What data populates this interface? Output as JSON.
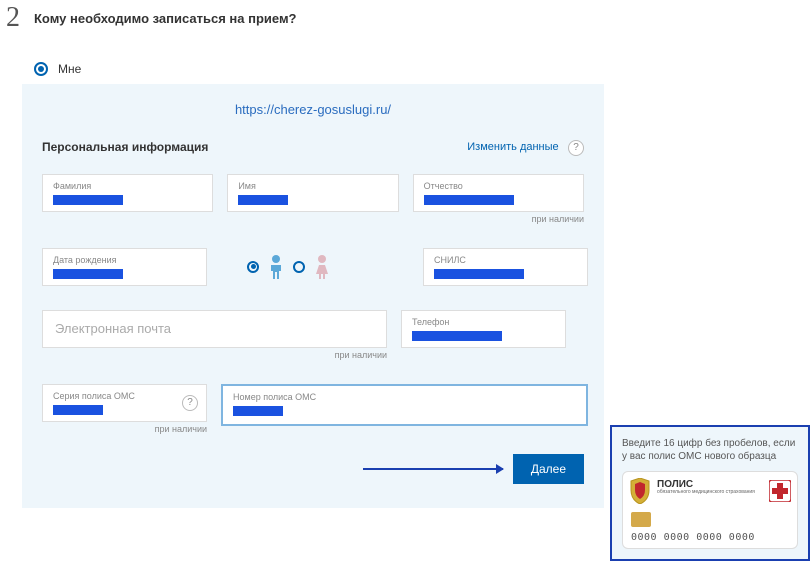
{
  "step": {
    "number": "2",
    "title": "Кому необходимо записаться на прием?"
  },
  "radio": {
    "me_label": "Мне"
  },
  "watermark": "https://cherez-gosuslugi.ru/",
  "section": {
    "title": "Персональная информация",
    "change_link": "Изменить данные",
    "help": "?"
  },
  "fields": {
    "surname_label": "Фамилия",
    "name_label": "Имя",
    "patronymic_label": "Отчество",
    "patronymic_helper": "при наличии",
    "birthdate_label": "Дата рождения",
    "snils_label": "СНИЛС",
    "email_placeholder": "Электронная почта",
    "email_helper": "при наличии",
    "phone_label": "Телефон",
    "polis_series_label": "Серия полиса ОМС",
    "polis_series_helper": "при наличии",
    "polis_number_label": "Номер полиса ОМС"
  },
  "buttons": {
    "next": "Далее"
  },
  "tooltip": {
    "text": "Введите 16 цифр без пробелов, если у вас полис ОМС нового образца",
    "card_title": "ПОЛИС",
    "card_sub": "обязательного медицинского\nстрахования",
    "card_digits": "0000 0000 0000 0000"
  }
}
